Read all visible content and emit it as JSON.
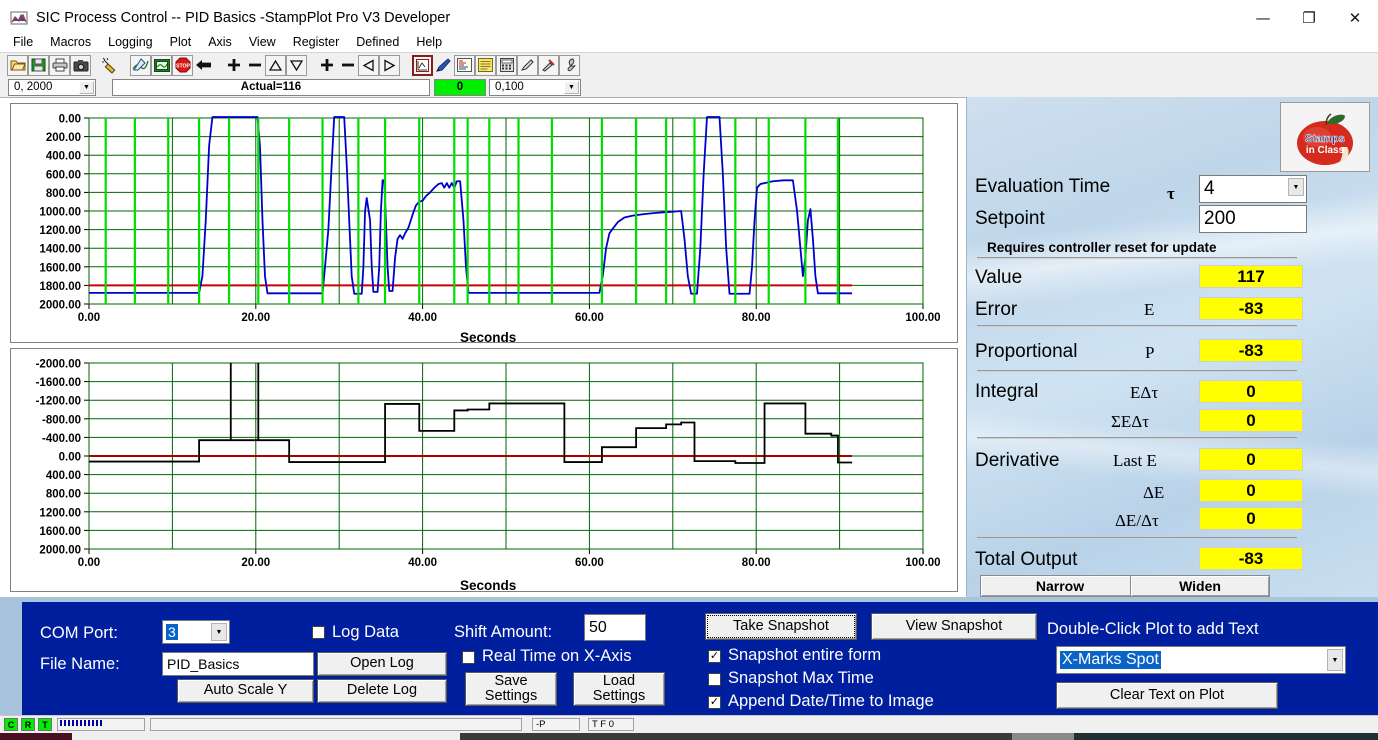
{
  "window": {
    "title": "SIC Process Control -- PID Basics -StampPlot Pro V3 Developer",
    "app_icon": "stampplot-icon",
    "minimize": "—",
    "maximize": "❐",
    "close": "✕"
  },
  "menu": {
    "items": [
      "File",
      "Macros",
      "Logging",
      "Plot",
      "Axis",
      "View",
      "Register",
      "Defined",
      "Help"
    ]
  },
  "toolbar": {
    "icons": [
      "open-folder-icon",
      "save-disk-icon",
      "print-icon",
      "camera-icon",
      "wand-icon",
      "pen-plot-icon",
      "monitor-icon",
      "stop-icon",
      "back-arrow-icon",
      "plus-icon",
      "minus-icon",
      "up-triangle-icon",
      "down-triangle-icon",
      "plus-icon-2",
      "minus-icon-2",
      "left-triangle-icon",
      "right-triangle-icon",
      "plot-window-icon",
      "pencil-icon",
      "text-image-icon",
      "notes-icon",
      "calculator-icon",
      "marker-icon",
      "tools-icon",
      "wrench-icon"
    ]
  },
  "bar2": {
    "left_combo_value": "0, 2000",
    "status_text": "Actual=116",
    "green_value": "0",
    "right_combo_value": "0,100"
  },
  "chart_data": [
    {
      "type": "line",
      "name": "process-value-plot",
      "title": "",
      "xlabel": "Seconds",
      "ylabel": "",
      "xlim": [
        0,
        100
      ],
      "ylim": [
        0,
        2000
      ],
      "xticks": [
        "0.00",
        "20.00",
        "40.00",
        "60.00",
        "80.00",
        "100.00"
      ],
      "yticks": [
        "0.00",
        "200.00",
        "400.00",
        "600.00",
        "800.00",
        "1000.00",
        "1200.00",
        "1400.00",
        "1600.00",
        "1800.00",
        "2000.00"
      ],
      "grid": true,
      "grid_color": "#006600",
      "series": [
        {
          "name": "setpoint-line",
          "color": "#cc0000",
          "style": "horizontal",
          "value": 200,
          "x_end": 91.5
        },
        {
          "name": "process-value",
          "color": "#0000cc",
          "points": [
            [
              0,
              120
            ],
            [
              13.2,
              120
            ],
            [
              13.6,
              300
            ],
            [
              14.0,
              900
            ],
            [
              14.4,
              1700
            ],
            [
              14.8,
              2010
            ],
            [
              20.2,
              2010
            ],
            [
              20.5,
              1700
            ],
            [
              20.8,
              900
            ],
            [
              21.1,
              300
            ],
            [
              21.4,
              115
            ],
            [
              28.0,
              115
            ],
            [
              28.3,
              400
            ],
            [
              28.7,
              800
            ],
            [
              29.1,
              1500
            ],
            [
              29.4,
              2010
            ],
            [
              30.6,
              2010
            ],
            [
              30.9,
              1500
            ],
            [
              31.2,
              900
            ],
            [
              31.5,
              300
            ],
            [
              31.8,
              110
            ],
            [
              32.7,
              110
            ],
            [
              32.9,
              400
            ],
            [
              33.1,
              1000
            ],
            [
              33.3,
              1140
            ],
            [
              33.7,
              900
            ],
            [
              33.9,
              400
            ],
            [
              34.1,
              130
            ],
            [
              34.6,
              130
            ],
            [
              34.8,
              400
            ],
            [
              35.0,
              1000
            ],
            [
              35.2,
              1330
            ],
            [
              35.4,
              1330
            ],
            [
              35.6,
              900
            ],
            [
              35.8,
              400
            ],
            [
              36.0,
              140
            ],
            [
              36.4,
              140
            ],
            [
              36.7,
              500
            ],
            [
              37.0,
              700
            ],
            [
              37.3,
              740
            ],
            [
              37.6,
              700
            ],
            [
              37.9,
              760
            ],
            [
              38.3,
              820
            ],
            [
              38.8,
              960
            ],
            [
              39.2,
              1060
            ],
            [
              39.6,
              1100
            ],
            [
              40.0,
              1110
            ],
            [
              40.4,
              1160
            ],
            [
              40.9,
              1200
            ],
            [
              41.4,
              1250
            ],
            [
              41.9,
              1290
            ],
            [
              42.3,
              1300
            ],
            [
              42.6,
              1250
            ],
            [
              42.9,
              1300
            ],
            [
              43.2,
              1250
            ],
            [
              43.5,
              1300
            ],
            [
              43.8,
              1250
            ],
            [
              44.1,
              1320
            ],
            [
              44.5,
              1320
            ],
            [
              44.9,
              900
            ],
            [
              45.2,
              400
            ],
            [
              45.5,
              120
            ],
            [
              53.0,
              120
            ],
            [
              53.4,
              120
            ],
            [
              61.2,
              120
            ],
            [
              61.6,
              300
            ],
            [
              62.0,
              600
            ],
            [
              62.4,
              760
            ],
            [
              62.8,
              810
            ],
            [
              63.4,
              880
            ],
            [
              64.2,
              930
            ],
            [
              65.2,
              950
            ],
            [
              66.4,
              965
            ],
            [
              68.0,
              980
            ],
            [
              69.6,
              990
            ],
            [
              71.0,
              1000
            ],
            [
              71.4,
              700
            ],
            [
              71.8,
              300
            ],
            [
              72.2,
              110
            ],
            [
              72.9,
              110
            ],
            [
              73.3,
              600
            ],
            [
              73.7,
              1400
            ],
            [
              74.1,
              2010
            ],
            [
              75.6,
              2010
            ],
            [
              76.0,
              1400
            ],
            [
              76.4,
              600
            ],
            [
              76.8,
              110
            ],
            [
              79.2,
              110
            ],
            [
              79.5,
              400
            ],
            [
              79.8,
              900
            ],
            [
              80.1,
              1250
            ],
            [
              80.5,
              1290
            ],
            [
              82.0,
              1320
            ],
            [
              83.3,
              1330
            ],
            [
              84.4,
              1330
            ],
            [
              84.9,
              1000
            ],
            [
              85.3,
              600
            ],
            [
              85.6,
              300
            ],
            [
              85.9,
              500
            ],
            [
              86.2,
              900
            ],
            [
              86.5,
              1020
            ],
            [
              86.8,
              700
            ],
            [
              87.1,
              300
            ],
            [
              87.4,
              115
            ],
            [
              91.5,
              115
            ]
          ]
        },
        {
          "name": "event-markers",
          "color": "#00dd00",
          "style": "vertical-bars",
          "x_positions": [
            2.0,
            5.5,
            9.5,
            13.2,
            16.8,
            20.3,
            24.0,
            28.0,
            32.3,
            35.5,
            39.6,
            43.8,
            45.4,
            48.0,
            51.5,
            55.5,
            61.5,
            65.6,
            69.2,
            72.6,
            77.5,
            81.5,
            85.9,
            89.8
          ]
        }
      ]
    },
    {
      "type": "line",
      "name": "controller-output-plot",
      "title": "",
      "xlabel": "Seconds",
      "ylabel": "",
      "xlim": [
        0,
        100
      ],
      "ylim": [
        -2000,
        2000
      ],
      "xticks": [
        "0.00",
        "20.00",
        "40.00",
        "60.00",
        "80.00",
        "100.00"
      ],
      "yticks": [
        "-2000.00",
        "-1600.00",
        "-1200.00",
        "-800.00",
        "-400.00",
        "0.00",
        "400.00",
        "800.00",
        "1200.00",
        "1600.00",
        "2000.00"
      ],
      "grid": true,
      "grid_color": "#006600",
      "series": [
        {
          "name": "zero-reference-line",
          "color": "#aa0000",
          "style": "horizontal",
          "value": 0,
          "x_end": 91.5
        },
        {
          "name": "total-output",
          "color": "#000000",
          "style": "step",
          "points": [
            [
              0,
              -120
            ],
            [
              13.2,
              -120
            ],
            [
              13.2,
              340
            ],
            [
              17.0,
              340
            ],
            [
              17.0,
              2000
            ],
            [
              17.0,
              340
            ],
            [
              20.3,
              340
            ],
            [
              20.3,
              2000
            ],
            [
              20.3,
              340
            ],
            [
              24.0,
              340
            ],
            [
              24.0,
              -130
            ],
            [
              35.5,
              -130
            ],
            [
              35.5,
              1120
            ],
            [
              39.6,
              1120
            ],
            [
              39.6,
              540
            ],
            [
              43.8,
              540
            ],
            [
              43.8,
              980
            ],
            [
              45.4,
              980
            ],
            [
              45.4,
              1000
            ],
            [
              48.0,
              1000
            ],
            [
              48.0,
              1130
            ],
            [
              53.0,
              1130
            ],
            [
              53.0,
              1130
            ],
            [
              57.0,
              1130
            ],
            [
              57.0,
              -130
            ],
            [
              61.5,
              -130
            ],
            [
              61.5,
              190
            ],
            [
              65.6,
              190
            ],
            [
              65.6,
              600
            ],
            [
              69.2,
              600
            ],
            [
              69.2,
              680
            ],
            [
              71.0,
              680
            ],
            [
              71.0,
              720
            ],
            [
              72.6,
              720
            ],
            [
              72.6,
              -110
            ],
            [
              77.5,
              -110
            ],
            [
              77.5,
              -150
            ],
            [
              79.2,
              -150
            ],
            [
              79.2,
              -150
            ],
            [
              81.0,
              -150
            ],
            [
              81.0,
              1130
            ],
            [
              85.9,
              1130
            ],
            [
              85.9,
              480
            ],
            [
              89.0,
              480
            ],
            [
              89.0,
              440
            ],
            [
              89.8,
              440
            ],
            [
              89.8,
              -140
            ],
            [
              91.5,
              -140
            ]
          ]
        }
      ]
    }
  ],
  "right_panel": {
    "logo_alt": "Stamps in Class apple logo",
    "evaluation_time": {
      "label": "Evaluation Time",
      "symbol": "τ",
      "value": "4"
    },
    "setpoint": {
      "label": "Setpoint",
      "value": "200"
    },
    "reset_note": "Requires controller reset for update",
    "rows": [
      {
        "label": "Value",
        "symbol": "",
        "value": "117"
      },
      {
        "label": "Error",
        "symbol": "E",
        "value": "-83"
      },
      {
        "label": "Proportional",
        "symbol": "P",
        "value": "-83"
      },
      {
        "label": "Integral",
        "symbol": "EΔτ",
        "value": "0"
      },
      {
        "label": "",
        "symbol": "ΣEΔτ",
        "value": "0"
      },
      {
        "label": "Derivative",
        "symbol": "Last E",
        "value": "0"
      },
      {
        "label": "",
        "symbol": "ΔE",
        "value": "0"
      },
      {
        "label": "",
        "symbol": "ΔE/Δτ",
        "value": "0"
      },
      {
        "label": "Total Output",
        "symbol": "",
        "value": "-83"
      }
    ],
    "narrow_button": "Narrow",
    "widen_button": "Widen"
  },
  "bottom_panel": {
    "com_port_label": "COM Port:",
    "com_port_value": "3",
    "file_name_label": "File Name:",
    "file_name_value": "PID_Basics",
    "auto_scale_button": "Auto Scale Y",
    "log_data_label": "Log Data",
    "log_data_checked": false,
    "open_log_button": "Open Log",
    "delete_log_button": "Delete Log",
    "shift_amount_label": "Shift Amount:",
    "shift_amount_value": "50",
    "real_time_label": "Real Time on X-Axis",
    "real_time_checked": false,
    "save_settings_button": "Save\nSettings",
    "save_settings_line1": "Save",
    "save_settings_line2": "Settings",
    "load_settings_line1": "Load",
    "load_settings_line2": "Settings",
    "take_snapshot_button": "Take Snapshot",
    "view_snapshot_button": "View Snapshot",
    "snapshot_form_label": "Snapshot entire form",
    "snapshot_form_checked": true,
    "snapshot_max_label": "Snapshot Max Time",
    "snapshot_max_checked": false,
    "append_datetime_label": "Append Date/Time to Image",
    "append_datetime_checked": true,
    "double_click_label": "Double-Click Plot to add Text",
    "text_combo_value": "X-Marks Spot",
    "clear_text_button": "Clear Text on Plot"
  },
  "status_bar": {
    "indicator_c": "C",
    "indicator_r": "R",
    "indicator_t": "T",
    "field_p": "-P",
    "field_tf0": "T F 0"
  },
  "colors": {
    "accent_blue": "#001f9e",
    "value_yellow": "#ffff00",
    "green_status": "#00ee00",
    "plot_blue": "#0000cc",
    "plot_red": "#cc0000",
    "plot_green": "#00dd00",
    "grid_green": "#006600"
  }
}
